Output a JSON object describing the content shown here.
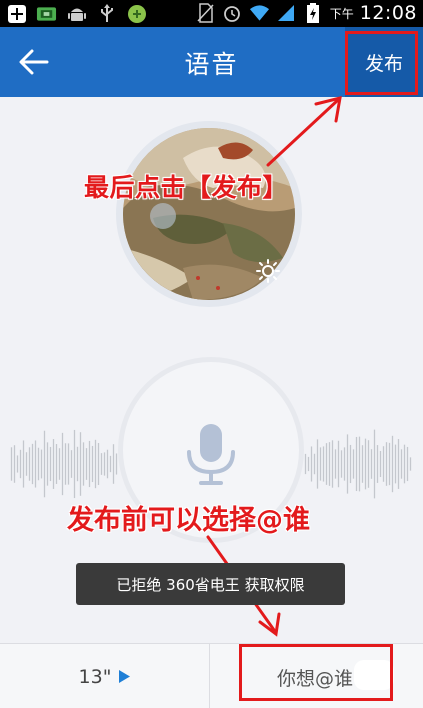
{
  "status_bar": {
    "period": "下午",
    "time": "12:08",
    "icons": [
      "add-icon",
      "usb-debug-icon",
      "android-icon",
      "usb-icon",
      "game-icon",
      "no-sim-icon",
      "alarm-icon",
      "wifi-icon",
      "signal-icon",
      "battery-charging-icon"
    ]
  },
  "header": {
    "title": "语音",
    "back_icon": "back-arrow-icon",
    "publish_label": "发布"
  },
  "annotations": {
    "step1": "最后点击【发布】",
    "step2": "发布前可以选择@谁"
  },
  "toast": "已拒绝 360省电王 获取权限",
  "bottom": {
    "duration": "13\"",
    "mention": "你想@谁"
  },
  "colors": {
    "header": "#1f6dc4",
    "publish_bg": "#155aa8",
    "annotation": "#e31a1c",
    "background": "#f1f2f6"
  }
}
